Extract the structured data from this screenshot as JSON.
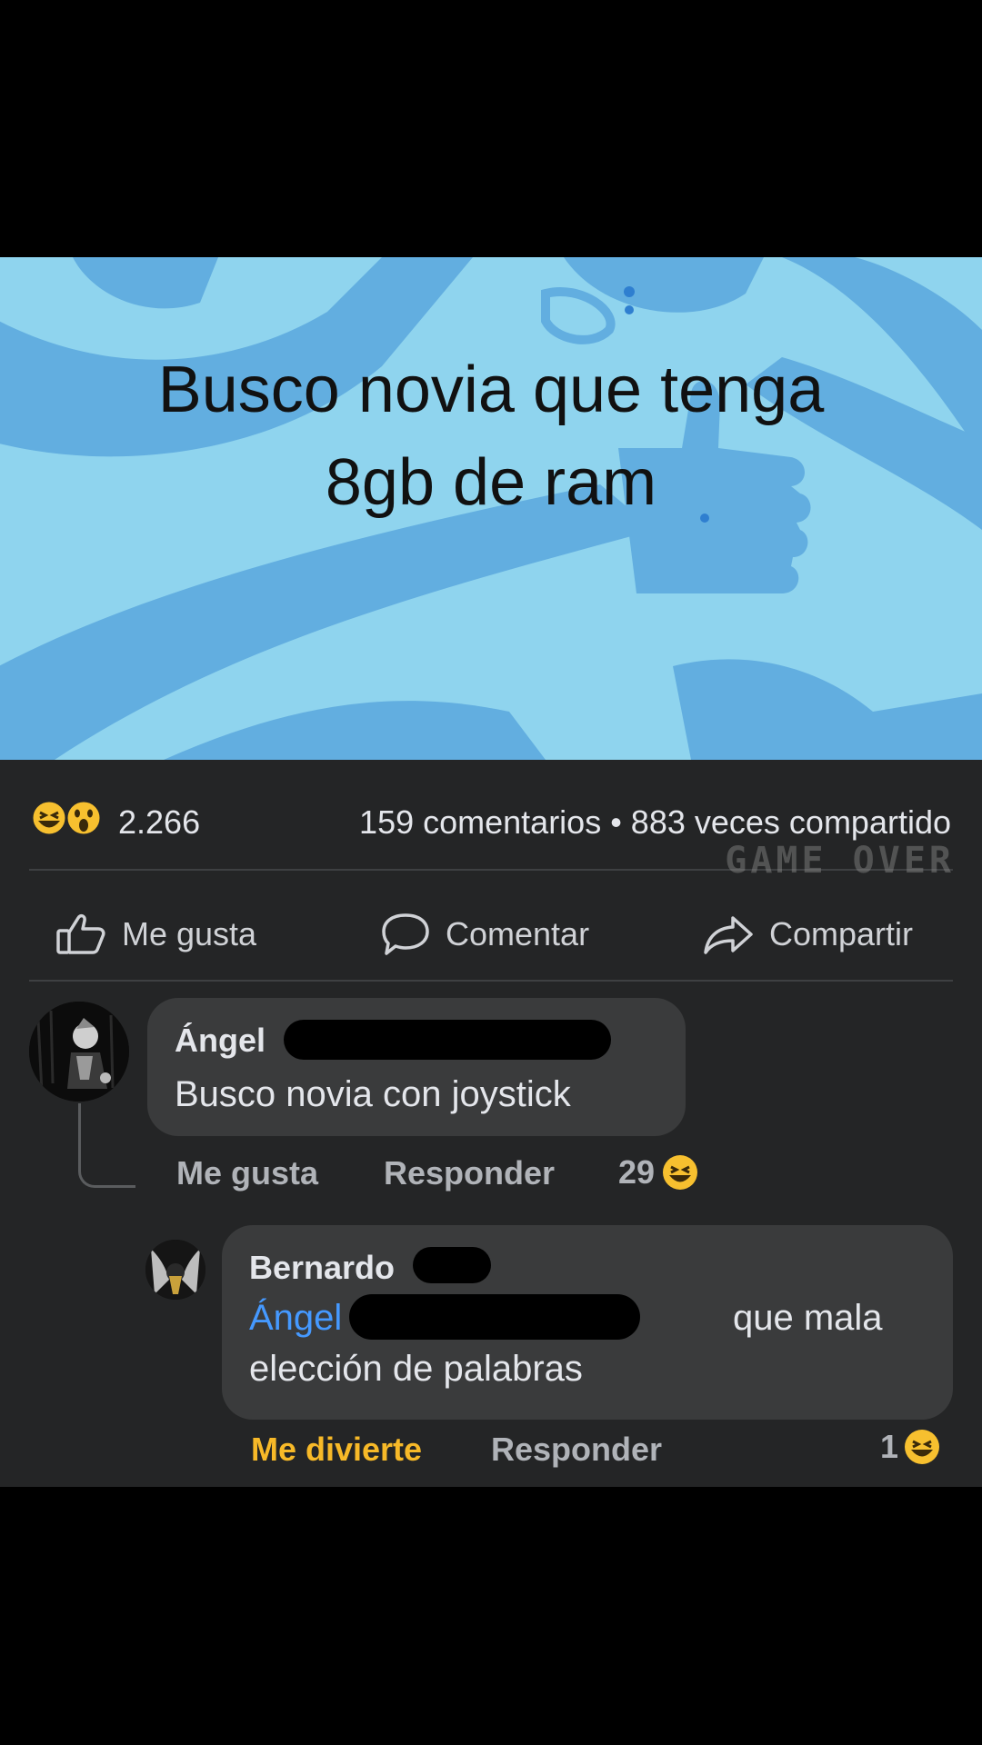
{
  "post": {
    "line1": "Busco novia que tenga",
    "line2": "8gb de ram"
  },
  "stats": {
    "reaction_count": "2.266",
    "comments_shares": "159 comentarios • 883 veces compartido",
    "watermark": "GAME OVER"
  },
  "actions": {
    "like": "Me gusta",
    "comment": "Comentar",
    "share": "Compartir"
  },
  "comments": [
    {
      "author": "Ángel",
      "text": "Busco novia con joystick",
      "like_label": "Me gusta",
      "reply_label": "Responder",
      "reaction_count": "29"
    },
    {
      "author": "Bernardo",
      "mention": "Ángel",
      "text_tail": "que mala",
      "text_line2": "elección de palabras",
      "like_label": "Me divierte",
      "reply_label": "Responder",
      "reaction_count": "1"
    }
  ],
  "colors": {
    "panel_bg": "#242526",
    "bubble_bg": "#3a3b3c",
    "mention": "#4599ff",
    "reacted": "#f7b928",
    "image_bg": "#8fd4ee"
  },
  "icons": [
    "haha-emoji-icon",
    "wow-emoji-icon",
    "thumbs-up-icon",
    "speech-bubble-icon",
    "share-arrow-icon"
  ]
}
